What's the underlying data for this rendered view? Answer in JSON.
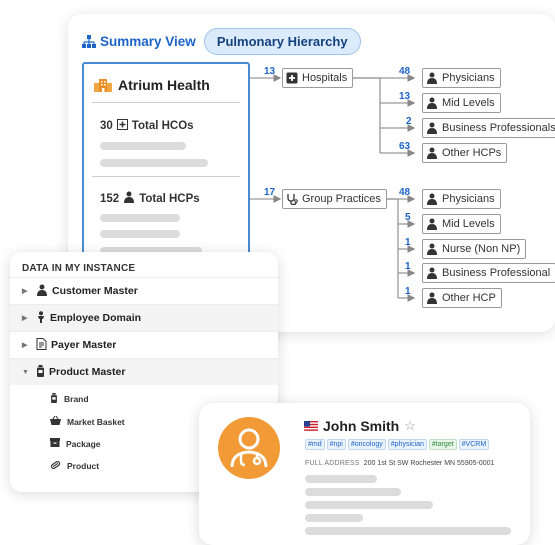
{
  "summary": {
    "title": "Summary View",
    "hierarchy_pill": "Pulmonary Hierarchy",
    "root": {
      "name": "Atrium Health",
      "hcos": {
        "count": "30",
        "label": "Total HCOs"
      },
      "hcps": {
        "count": "152",
        "label": "Total HCPs"
      }
    },
    "groups": [
      {
        "count": "13",
        "label": "Hospitals",
        "icon": "hospital-icon",
        "children": [
          {
            "count": "48",
            "label": "Physicians"
          },
          {
            "count": "13",
            "label": "Mid Levels"
          },
          {
            "count": "2",
            "label": "Business Professionals"
          },
          {
            "count": "63",
            "label": "Other HCPs"
          }
        ]
      },
      {
        "count": "17",
        "label": "Group Practices",
        "icon": "stethoscope-icon",
        "children": [
          {
            "count": "48",
            "label": "Physicians"
          },
          {
            "count": "5",
            "label": "Mid Levels"
          },
          {
            "count": "1",
            "label": "Nurse (Non NP)"
          },
          {
            "count": "1",
            "label": "Business Professional"
          },
          {
            "count": "1",
            "label": "Other HCP"
          }
        ]
      }
    ]
  },
  "data_panel": {
    "heading": "DATA IN MY INSTANCE",
    "items": [
      {
        "label": "Customer Master",
        "icon": "people-icon",
        "expanded": false
      },
      {
        "label": "Employee Domain",
        "icon": "person-icon",
        "expanded": false
      },
      {
        "label": "Payer Master",
        "icon": "document-icon",
        "expanded": false
      },
      {
        "label": "Product Master",
        "icon": "bottle-icon",
        "expanded": true
      }
    ],
    "sub_items": [
      {
        "label": "Brand",
        "icon": "bottle-icon"
      },
      {
        "label": "Market Basket",
        "icon": "basket-icon"
      },
      {
        "label": "Package",
        "icon": "package-icon"
      },
      {
        "label": "Product",
        "icon": "pill-icon"
      }
    ]
  },
  "profile": {
    "name": "John Smith",
    "flag": "us-flag-icon",
    "tags": [
      "#md",
      "#npi",
      "#oncology",
      "#physician",
      "#target",
      "#VCRM"
    ],
    "address_label": "FULL ADDRESS",
    "address": "200 1st St SW Rochester MN 55905-0001"
  },
  "colors": {
    "accent_blue": "#1d64c8",
    "pill_bg": "#dcebfb",
    "root_border": "#4a8ad4",
    "avatar_orange": "#f19a36",
    "placeholder_gray": "#dcdcdc",
    "tag_green": "#2f8a3d"
  }
}
